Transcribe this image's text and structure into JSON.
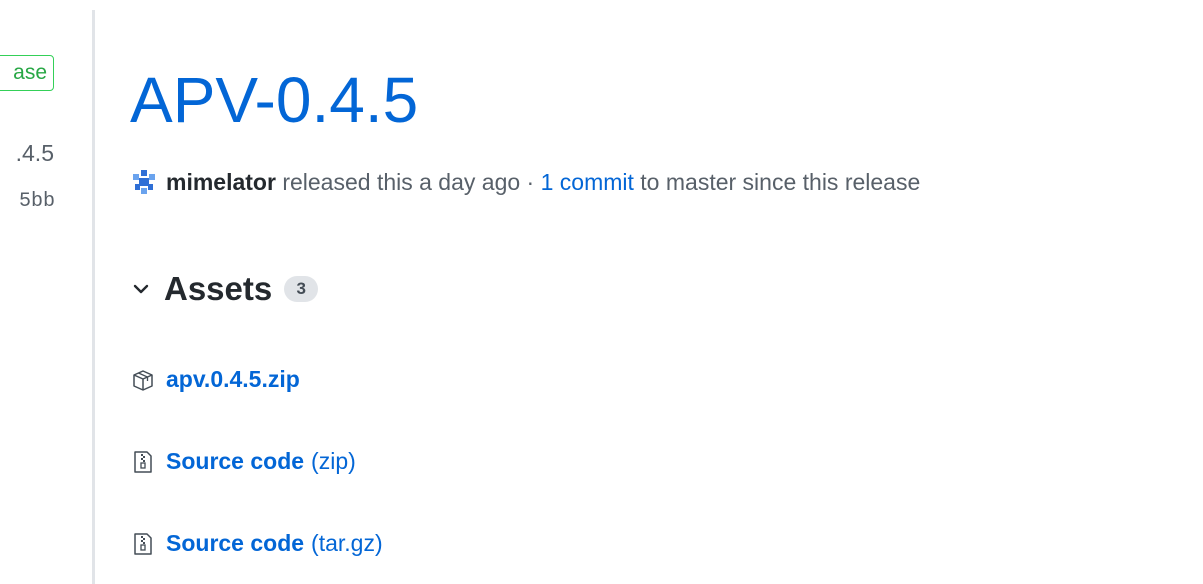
{
  "sidebar": {
    "label_badge": "ase",
    "tag_name": ".4.5",
    "commit_sha": "5bb"
  },
  "release": {
    "title": "APV-0.4.5",
    "author": "mimelator",
    "released_text": "released this a day ago ·",
    "commits_link": "1 commit",
    "commits_suffix": "to master since this release"
  },
  "assets": {
    "title": "Assets",
    "count": "3",
    "items": [
      {
        "name": "apv.0.4.5.zip",
        "suffix": "",
        "icon": "package-icon"
      },
      {
        "name": "Source code",
        "suffix": "(zip)",
        "icon": "file-zip-icon"
      },
      {
        "name": "Source code",
        "suffix": "(tar.gz)",
        "icon": "file-zip-icon"
      }
    ]
  },
  "colors": {
    "link": "#0366d6",
    "muted": "#586069",
    "badge_green": "#28a745",
    "divider": "#e1e4e8"
  }
}
